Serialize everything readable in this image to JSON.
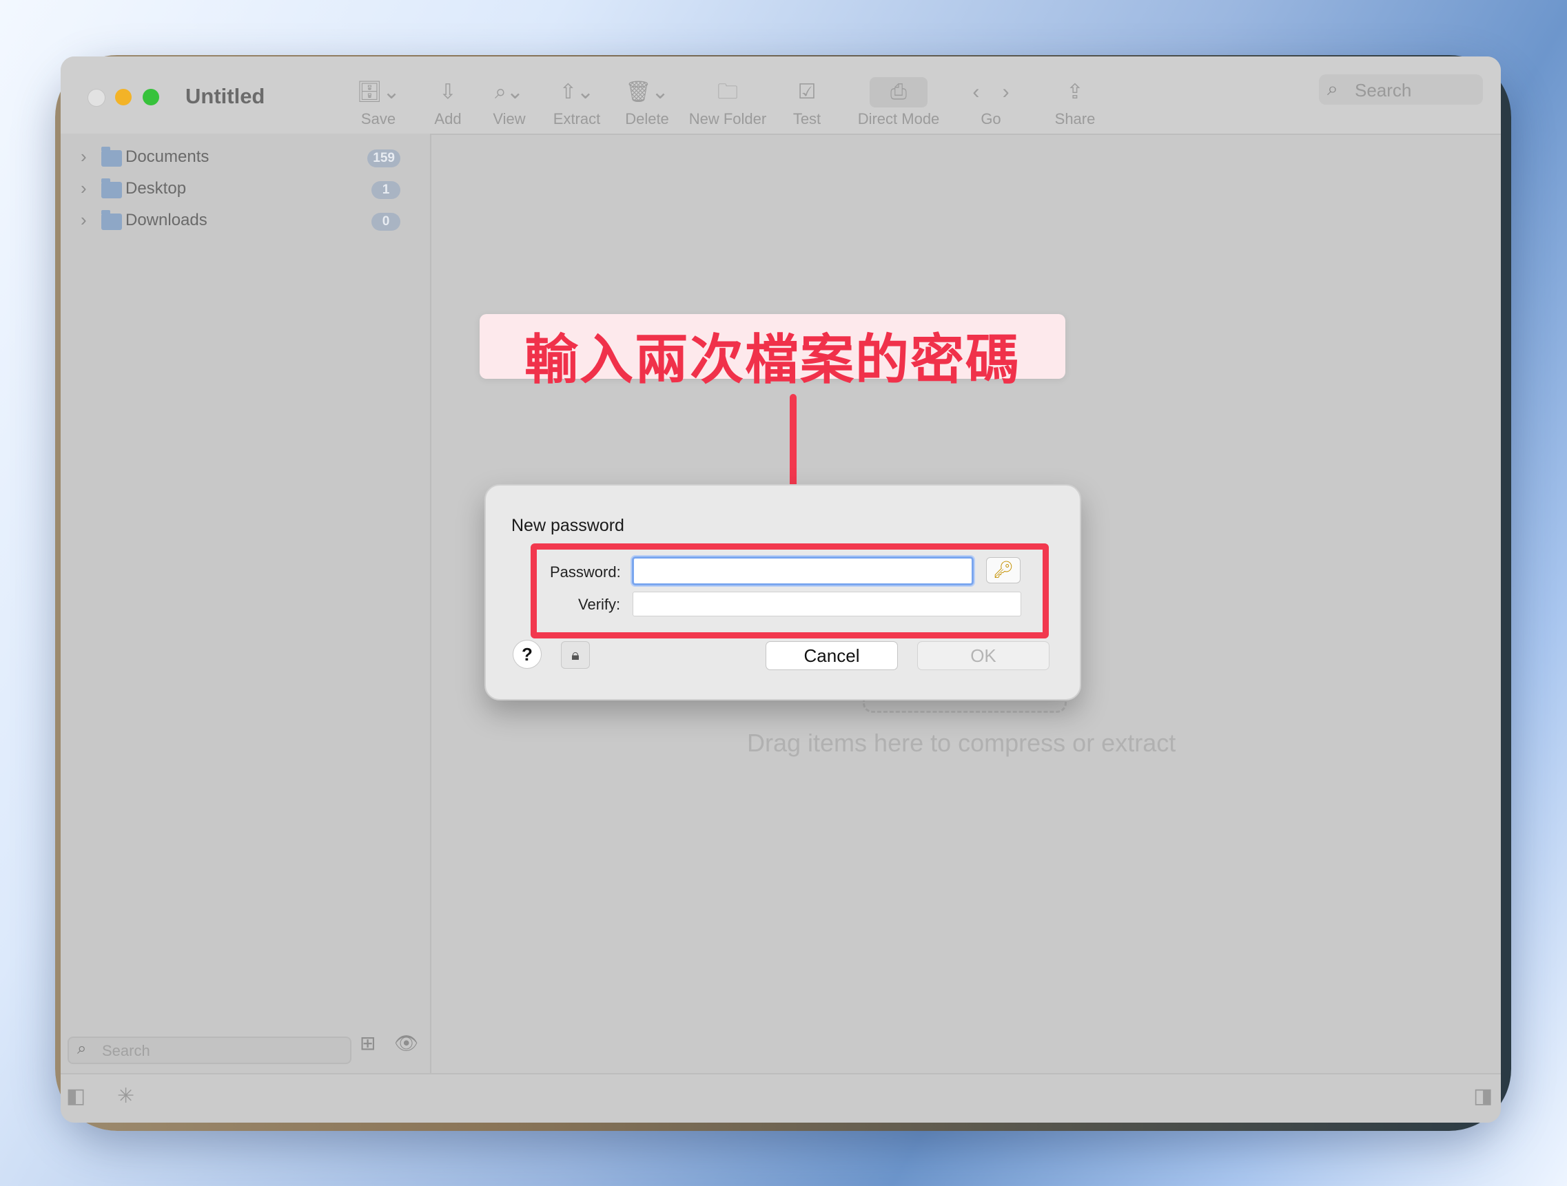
{
  "window": {
    "title": "Untitled"
  },
  "toolbar": {
    "items": [
      {
        "label": "Save",
        "icon": "archive-icon"
      },
      {
        "label": "Add",
        "icon": "add-icon"
      },
      {
        "label": "View",
        "icon": "view-icon"
      },
      {
        "label": "Extract",
        "icon": "extract-icon"
      },
      {
        "label": "Delete",
        "icon": "trash-icon"
      },
      {
        "label": "New Folder",
        "icon": "new-folder-icon"
      },
      {
        "label": "Test",
        "icon": "checkmark-icon"
      },
      {
        "label": "Direct Mode",
        "icon": "direct-mode-icon"
      },
      {
        "label": "Go",
        "icon": "back-forward-icon"
      },
      {
        "label": "Share",
        "icon": "share-icon"
      }
    ],
    "search_placeholder": "Search"
  },
  "sidebar": {
    "items": [
      {
        "name": "Documents",
        "count": "159"
      },
      {
        "name": "Desktop",
        "count": "1"
      },
      {
        "name": "Downloads",
        "count": "0"
      }
    ],
    "search_placeholder": "Search"
  },
  "main": {
    "drop_text": "Drag items here to compress or extract"
  },
  "annotation": {
    "text": "輸入兩次檔案的密碼",
    "color": "#f0314a"
  },
  "dialog": {
    "title": "New password",
    "password_label": "Password:",
    "verify_label": "Verify:",
    "password_value": "",
    "verify_value": "",
    "help_label": "?",
    "cancel_label": "Cancel",
    "ok_label": "OK"
  }
}
